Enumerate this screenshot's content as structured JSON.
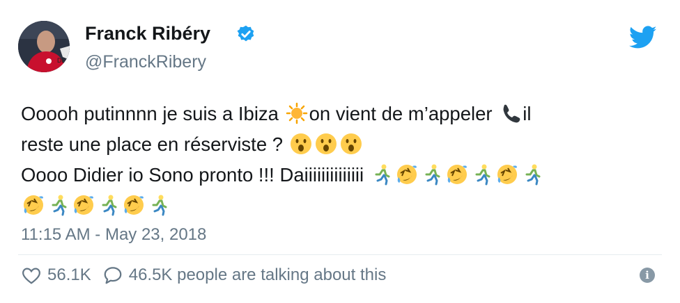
{
  "author": {
    "name": "Franck Ribéry",
    "handle": "@FranckRibery"
  },
  "tweet": {
    "line1_a": "Ooooh putinnnn je suis a Ibiza ",
    "line1_b": "on vient de m’appeler ",
    "line1_c": "il",
    "line2": "reste une place en réserviste ? ",
    "line3": "Oooo Didier io Sono pronto !!! Daiiiiiiiiiiiiii "
  },
  "timestamp": "11:15 AM - May 23, 2018",
  "actions": {
    "likes": "56.1K",
    "talking": "46.5K people are talking about this"
  },
  "icons": {
    "verified": "verified-badge-icon",
    "brand": "twitter-bird-icon",
    "like": "heart-icon",
    "reply": "speech-bubble-icon",
    "info": "info-icon"
  },
  "colors": {
    "text": "#14171a",
    "muted": "#657786",
    "twitter_blue": "#1da1f2"
  }
}
